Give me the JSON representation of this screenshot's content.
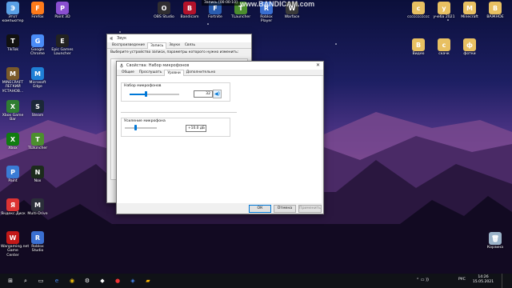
{
  "desktop_left_col": [
    {
      "name": "computer",
      "label": "Этот компьютер",
      "color": "#5aa0e6"
    },
    {
      "name": "tiktok",
      "label": "TikTok",
      "color": "#111111"
    },
    {
      "name": "minecraft-launcher",
      "label": "MINECRAFT ЛЕГКИЙ УСТАНОВ...",
      "color": "#7a5a2a"
    },
    {
      "name": "xbox-game-bar",
      "label": "Xbox Game Bar",
      "color": "#2f7d32"
    },
    {
      "name": "xbox",
      "label": "Xbox",
      "color": "#107c10"
    },
    {
      "name": "paint",
      "label": "Paint",
      "color": "#3a7bd5"
    },
    {
      "name": "yandex-disk",
      "label": "Яндекс.Диск",
      "color": "#d33"
    },
    {
      "name": "wargaming",
      "label": "Wargaming.net Game Center",
      "color": "#c21818"
    }
  ],
  "desktop_col2": [
    {
      "name": "firefox",
      "label": "Firefox",
      "color": "#ff7a1a"
    },
    {
      "name": "chrome",
      "label": "Google Chrome",
      "color": "#4a8cf7"
    },
    {
      "name": "edge",
      "label": "Microsoft Edge",
      "color": "#1f7fd6"
    },
    {
      "name": "steam",
      "label": "Steam",
      "color": "#1b2838"
    },
    {
      "name": "tlauncher",
      "label": "TLauncher",
      "color": "#4c8f2e"
    },
    {
      "name": "nox",
      "label": "Nox",
      "color": "#1c2b1c"
    },
    {
      "name": "multi-drive",
      "label": "Multi-Drive",
      "color": "#2b2f3a"
    },
    {
      "name": "roblox-studio",
      "label": "Roblox Studio",
      "color": "#3a6fd1"
    }
  ],
  "desktop_col3": [
    {
      "name": "paint3d",
      "label": "Paint 3D",
      "color": "#8a4fd1"
    },
    {
      "name": "epic",
      "label": "Epic Games Launcher",
      "color": "#222222"
    }
  ],
  "desktop_top_row": [
    {
      "name": "obs",
      "label": "OBS Studio",
      "color": "#302e31"
    },
    {
      "name": "bandicam",
      "label": "Bandicam",
      "color": "#b3122a"
    },
    {
      "name": "fortnite",
      "label": "Fortnite",
      "color": "#2a5db0"
    },
    {
      "name": "tlauncher2",
      "label": "TLauncher",
      "color": "#4c8f2e"
    },
    {
      "name": "roblox-player",
      "label": "Roblox Player",
      "color": "#3a6fd1"
    },
    {
      "name": "warface",
      "label": "Warface",
      "color": "#3a3a3a"
    }
  ],
  "desktop_right": [
    {
      "name": "folder-1",
      "label": "ссссссссссс",
      "color": "#e8c062"
    },
    {
      "name": "folder-2",
      "label": "учеба 2021",
      "color": "#e8c062"
    },
    {
      "name": "folder-3",
      "label": "Minecraft",
      "color": "#e8c062"
    },
    {
      "name": "folder-4",
      "label": "ВАЖНОЕ",
      "color": "#e8c062"
    },
    {
      "name": "folder-5",
      "label": "Видео",
      "color": "#e8c062"
    },
    {
      "name": "folder-6",
      "label": "скачк",
      "color": "#e8c062"
    },
    {
      "name": "folder-7",
      "label": "фотки",
      "color": "#e8c062"
    }
  ],
  "recycle_bin": {
    "label": "Корзина"
  },
  "recording_banner": "Запись [00:00:10]",
  "watermark": "www.BANDICAM.com",
  "sound_window": {
    "title": "Звук",
    "tabs": [
      "Воспроизведение",
      "Запись",
      "Звуки",
      "Связь"
    ],
    "active_tab": 1,
    "hint": "Выберите устройство записи, параметры которого нужно изменить:"
  },
  "mic_window": {
    "title": "Свойства: Набор микрофонов",
    "tabs": [
      "Общие",
      "Прослушать",
      "Уровни",
      "Дополнительно"
    ],
    "active_tab": 2,
    "level_label": "Набор микрофонов",
    "level_value": "32",
    "level_fraction": 0.32,
    "boost_label": "Усиление микрофона",
    "boost_value": "+10.0 дБ",
    "boost_fraction": 0.33,
    "ok": "ОК",
    "cancel": "Отмена",
    "apply": "Применить"
  },
  "taskbar": {
    "lang": "РУС",
    "time": "14:26",
    "date": "15.05.2021"
  }
}
